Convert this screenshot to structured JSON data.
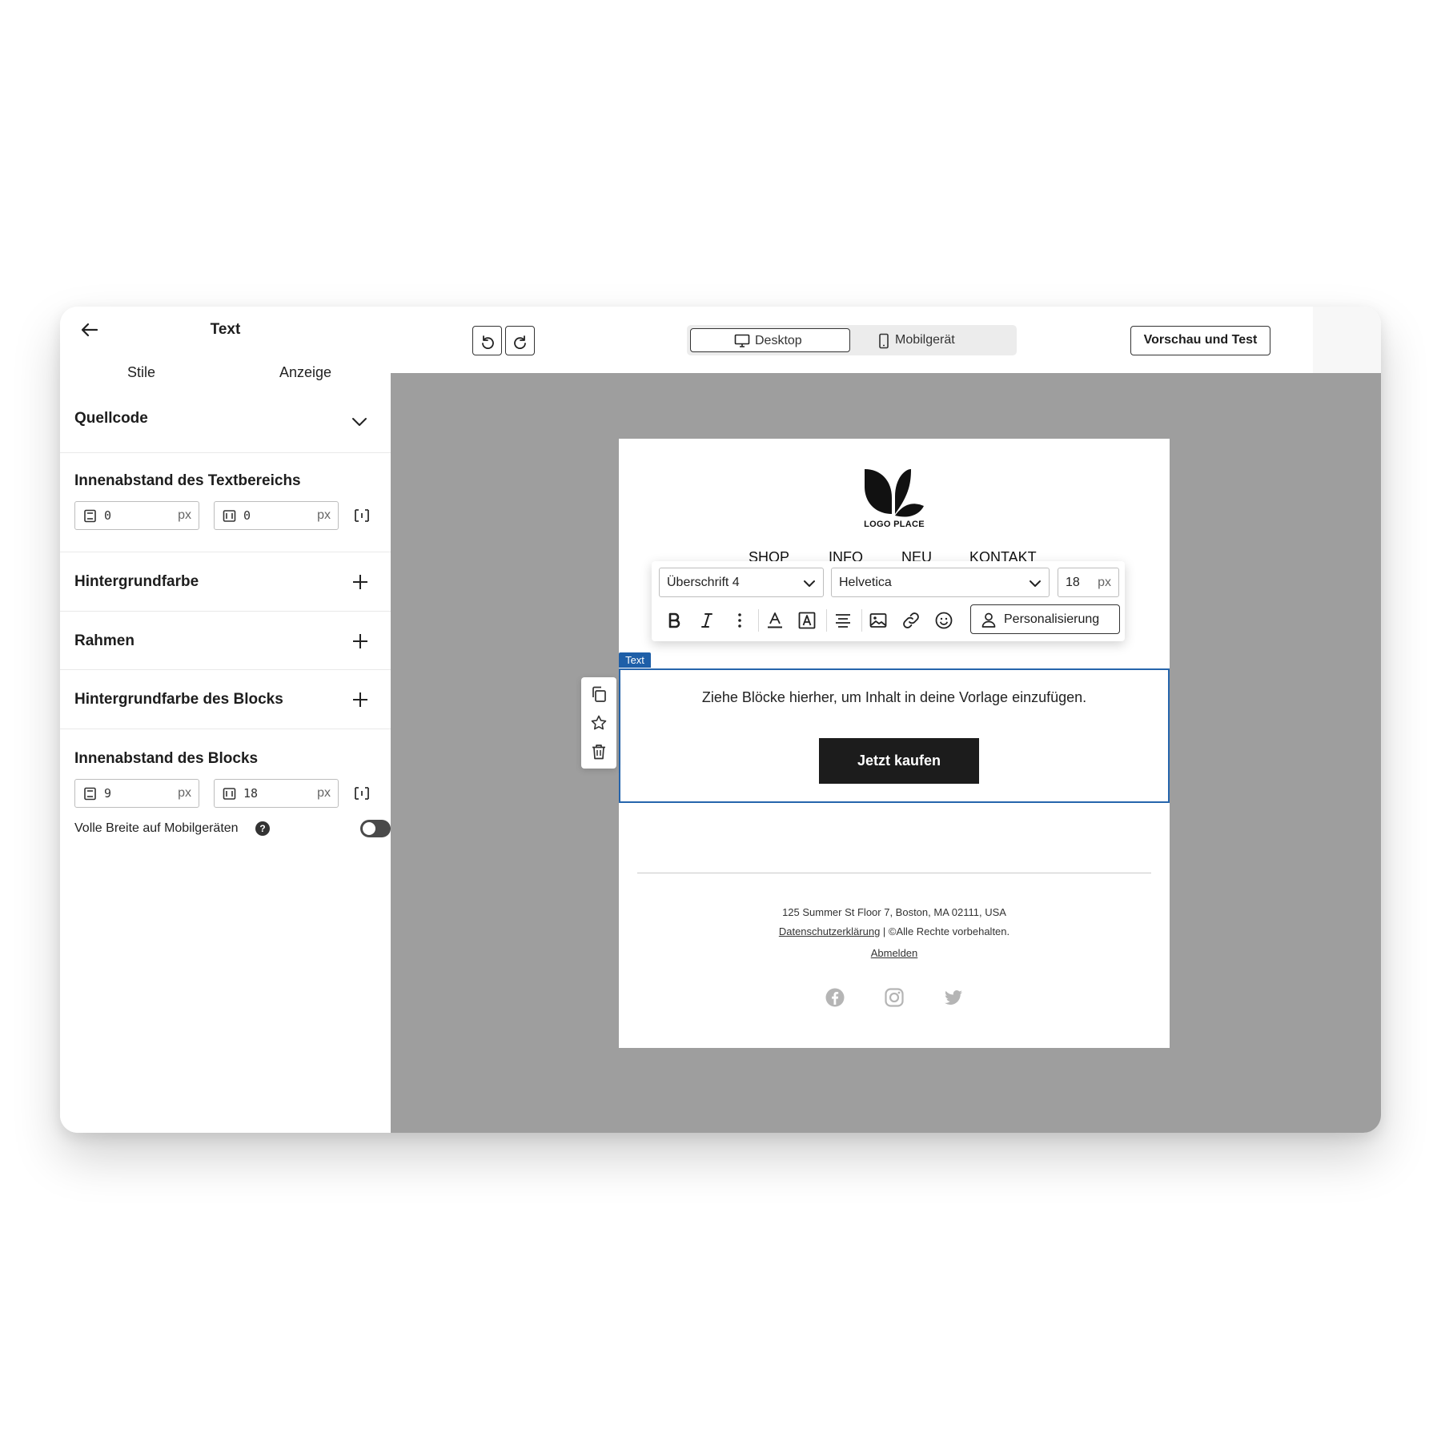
{
  "sidebar": {
    "title": "Text",
    "tabs": [
      "Stile",
      "Anzeige"
    ],
    "source_code_label": "Quellcode",
    "text_padding": {
      "label": "Innenabstand des Textbereichs",
      "vertical": "0",
      "horizontal": "0",
      "unit": "px"
    },
    "background_color_label": "Hintergrundfarbe",
    "border_label": "Rahmen",
    "block_background_label": "Hintergrundfarbe des Blocks",
    "block_padding": {
      "label": "Innenabstand des Blocks",
      "vertical": "9",
      "horizontal": "18",
      "unit": "px"
    },
    "full_width_mobile_label": "Volle Breite auf Mobilgeräten",
    "full_width_mobile_on": false
  },
  "topbar": {
    "device_desktop": "Desktop",
    "device_mobile": "Mobilgerät",
    "active_device": "Desktop",
    "preview_button": "Vorschau und Test"
  },
  "email": {
    "logo_text": "LOGO PLACE",
    "nav": [
      "SHOP",
      "INFO",
      "NEU",
      "KONTAKT"
    ],
    "block_tag": "Text",
    "body_text": "Ziehe Blöcke hierher, um Inhalt in deine Vorlage einzufügen.",
    "cta_label": "Jetzt kaufen",
    "footer": {
      "address": "125 Summer St Floor 7, Boston, MA 02111, USA",
      "privacy_link": "Datenschutzerklärung",
      "rights": " | ©Alle Rechte vorbehalten.",
      "unsubscribe": "Abmelden"
    },
    "social_icons": [
      "facebook-icon",
      "instagram-icon",
      "twitter-icon"
    ]
  },
  "text_toolbar": {
    "style_select": "Überschrift 4",
    "font_select": "Helvetica",
    "font_size": "18",
    "font_size_unit": "px",
    "personalize_label": "Personalisierung"
  },
  "colors": {
    "canvas_bg": "#9e9e9e",
    "selection_blue": "#2665ac",
    "cta_bg": "#1c1c1c"
  }
}
